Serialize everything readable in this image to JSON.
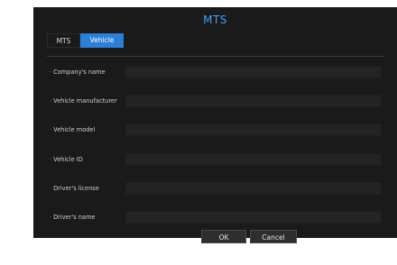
{
  "dialog": {
    "title": "MTS",
    "tabs": [
      {
        "label": "MTS",
        "active": false
      },
      {
        "label": "Vehicle",
        "active": true
      }
    ],
    "fields": [
      {
        "label": "Company's name",
        "value": ""
      },
      {
        "label": "Vehicle manufacturer",
        "value": ""
      },
      {
        "label": "Vehicle model",
        "value": ""
      },
      {
        "label": "Vehicle ID",
        "value": ""
      },
      {
        "label": "Driver's license",
        "value": ""
      },
      {
        "label": "Driver's name",
        "value": ""
      }
    ],
    "buttons": {
      "ok": "OK",
      "cancel": "Cancel"
    },
    "colors": {
      "accent": "#2a7fd8",
      "title": "#3fa0ff",
      "background": "#1a1a1a"
    }
  }
}
